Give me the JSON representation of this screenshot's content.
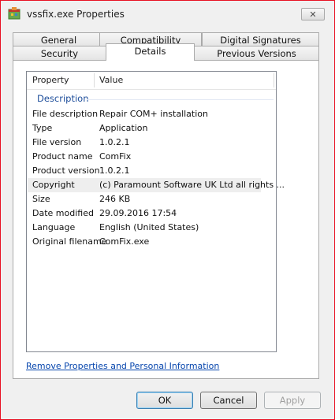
{
  "window": {
    "title": "vssfix.exe Properties",
    "close_glyph": "✕"
  },
  "tabs": {
    "row_back": [
      "General",
      "Compatibility",
      "Digital Signatures"
    ],
    "row_front": [
      "Security",
      "Details",
      "Previous Versions"
    ],
    "active": "Details"
  },
  "details": {
    "columns": {
      "property": "Property",
      "value": "Value"
    },
    "group": "Description",
    "rows": [
      {
        "property": "File description",
        "value": "Repair COM+ installation"
      },
      {
        "property": "Type",
        "value": "Application"
      },
      {
        "property": "File version",
        "value": "1.0.2.1"
      },
      {
        "property": "Product name",
        "value": "ComFix"
      },
      {
        "property": "Product version",
        "value": "1.0.2.1"
      },
      {
        "property": "Copyright",
        "value": "(c) Paramount Software UK Ltd all rights ..."
      },
      {
        "property": "Size",
        "value": "246 KB"
      },
      {
        "property": "Date modified",
        "value": "29.09.2016 17:54"
      },
      {
        "property": "Language",
        "value": "English (United States)"
      },
      {
        "property": "Original filename",
        "value": "ComFix.exe"
      }
    ],
    "selected_row": "Copyright"
  },
  "link": {
    "label": "Remove Properties and Personal Information"
  },
  "buttons": {
    "ok": "OK",
    "cancel": "Cancel",
    "apply": "Apply"
  },
  "icons": {
    "title_icon": "application-icon",
    "close": "close-icon"
  },
  "colors": {
    "group_header": "#1e4e9b",
    "link": "#0645ad",
    "window_border": "#e81123"
  }
}
